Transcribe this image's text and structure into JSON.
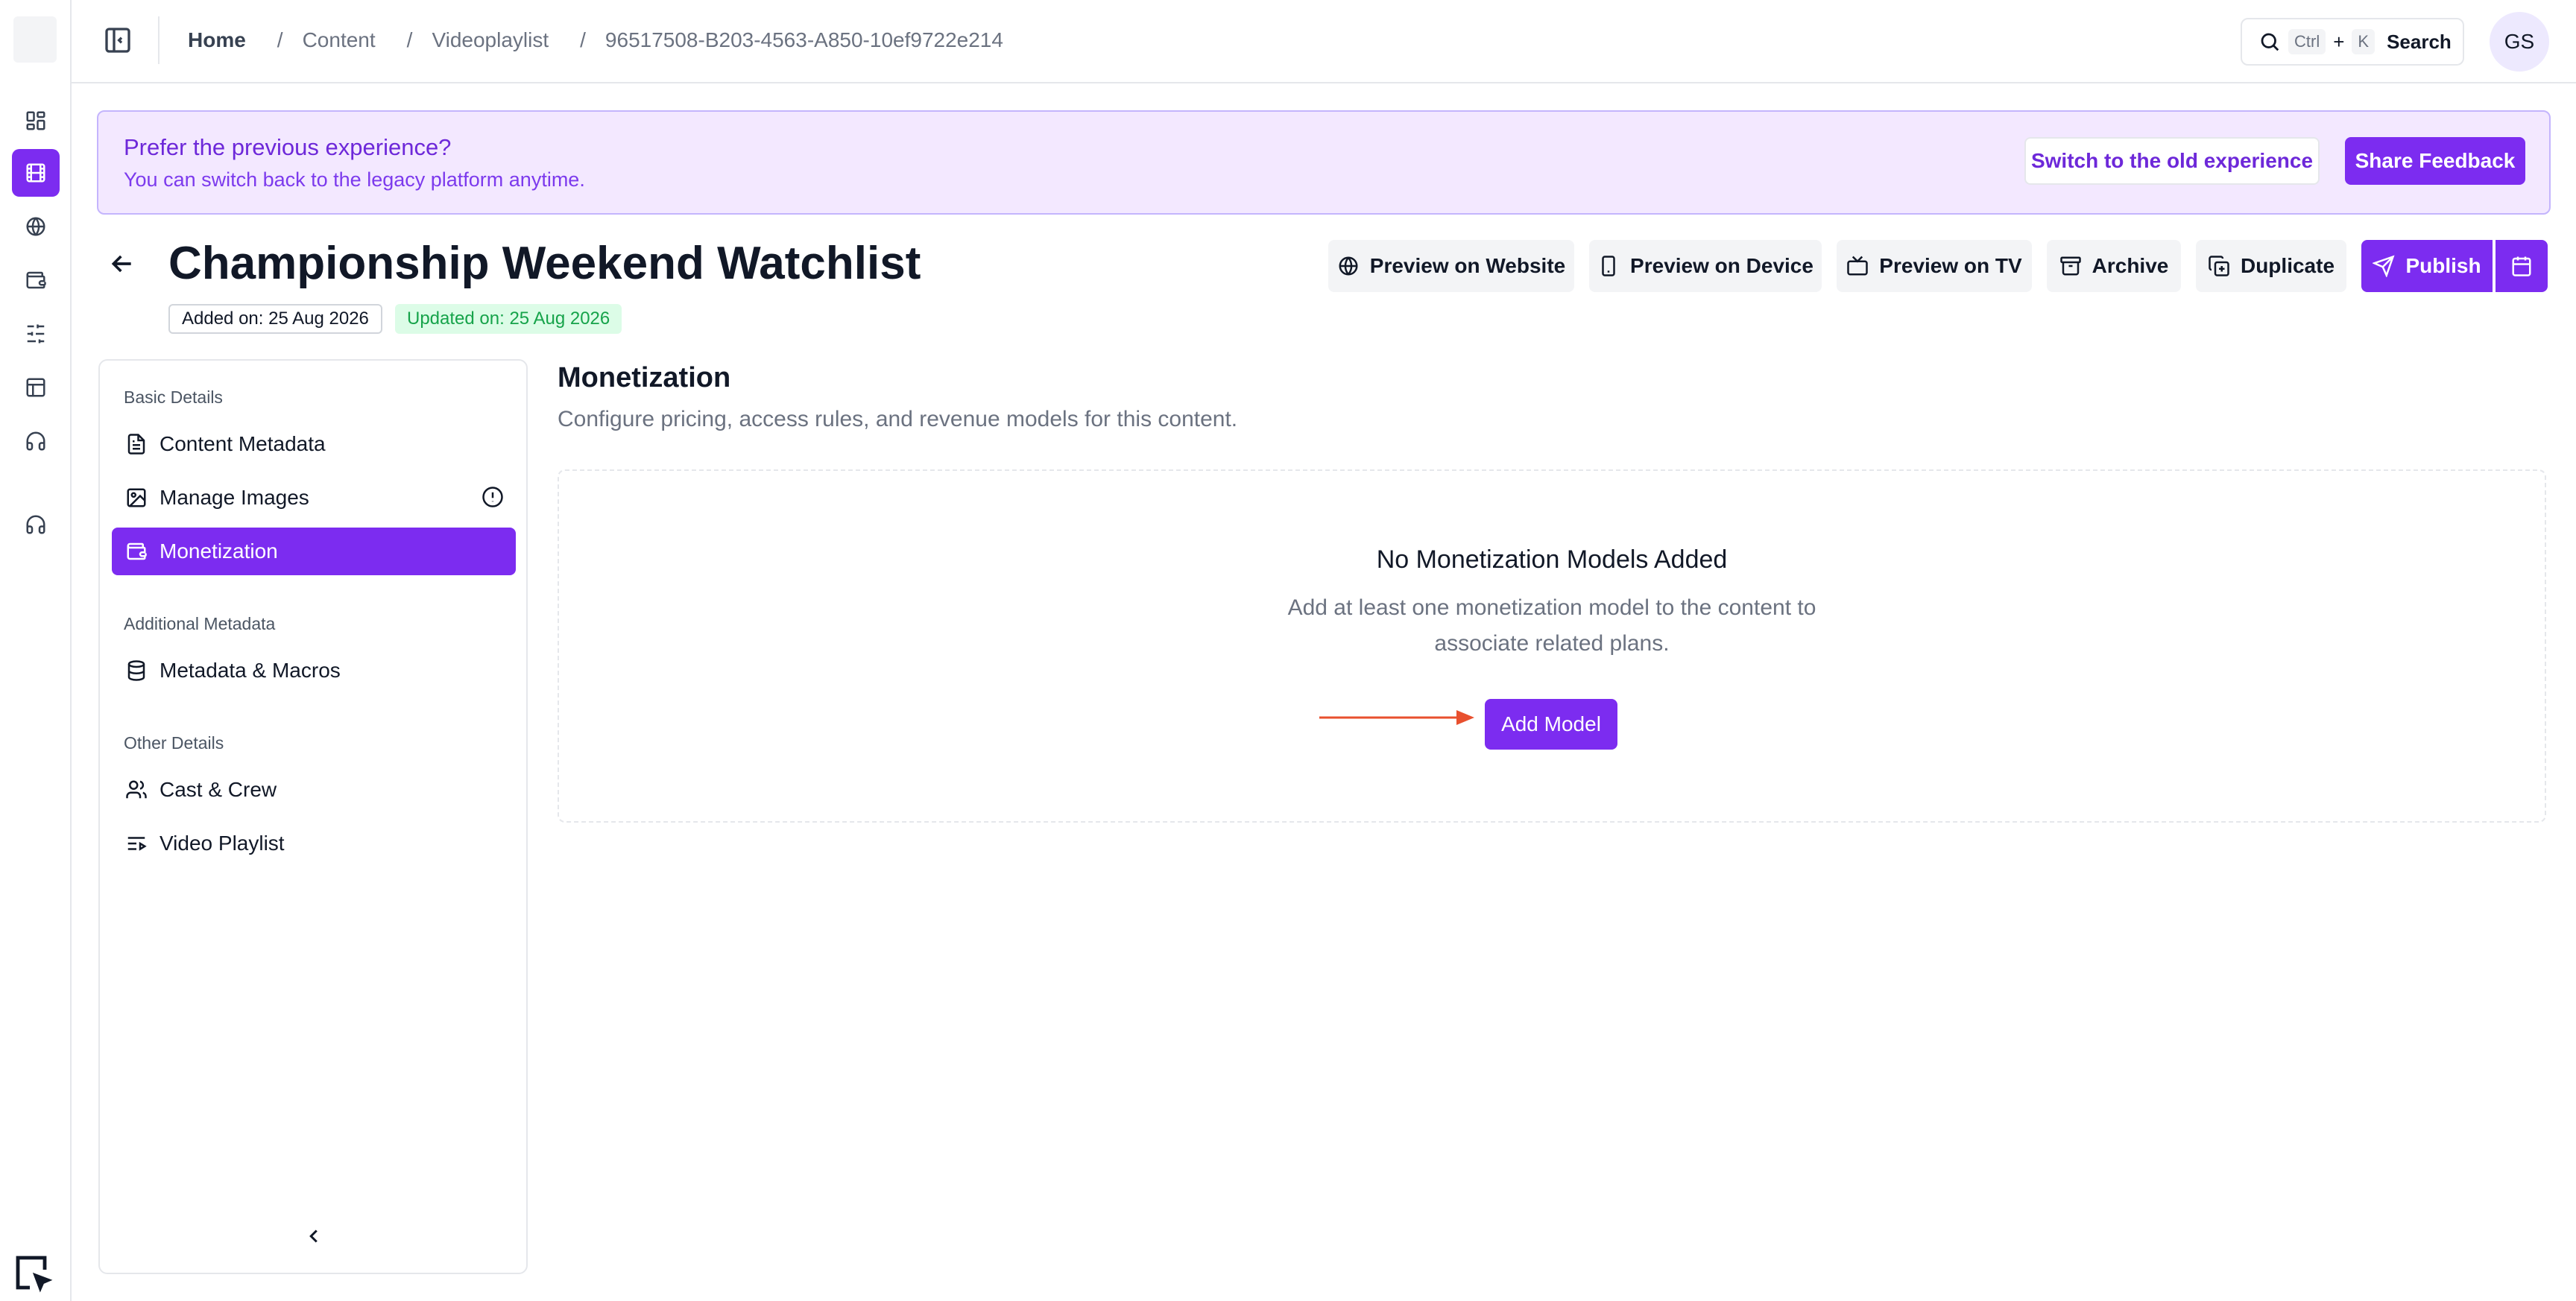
{
  "breadcrumb": {
    "home": "Home",
    "items": [
      "Content",
      "Videoplaylist",
      "96517508-B203-4563-A850-10ef9722e214"
    ]
  },
  "search": {
    "kbd_ctrl": "Ctrl",
    "kbd_plus": "+",
    "kbd_k": "K",
    "label": "Search"
  },
  "user": {
    "initials": "GS"
  },
  "banner": {
    "title": "Prefer the previous experience?",
    "subtitle": "You can switch back to the legacy platform anytime.",
    "switch_label": "Switch to the old experience",
    "feedback_label": "Share Feedback"
  },
  "page": {
    "title": "Championship Weekend Watchlist",
    "added_on": "Added on: 25 Aug 2026",
    "updated_on": "Updated on: 25 Aug 2026"
  },
  "actions": {
    "preview_website": "Preview on Website",
    "preview_device": "Preview on Device",
    "preview_tv": "Preview on TV",
    "archive": "Archive",
    "duplicate": "Duplicate",
    "publish": "Publish"
  },
  "sidebar": {
    "groups": {
      "basic": "Basic Details",
      "additional": "Additional Metadata",
      "other": "Other Details"
    },
    "items": {
      "content_metadata": "Content Metadata",
      "manage_images": "Manage Images",
      "monetization": "Monetization",
      "metadata_macros": "Metadata & Macros",
      "cast_crew": "Cast & Crew",
      "video_playlist": "Video Playlist"
    }
  },
  "main": {
    "title": "Monetization",
    "subtitle": "Configure pricing, access rules, and revenue models for this content.",
    "empty_title": "No Monetization Models Added",
    "empty_desc": "Add at least one monetization model to the content to associate related plans.",
    "add_button": "Add Model"
  },
  "colors": {
    "accent": "#7c2cf0",
    "banner_bg": "#f3e8ff",
    "arrow": "#e8502e",
    "warning": "#dc2626",
    "success": "#16a34a"
  }
}
